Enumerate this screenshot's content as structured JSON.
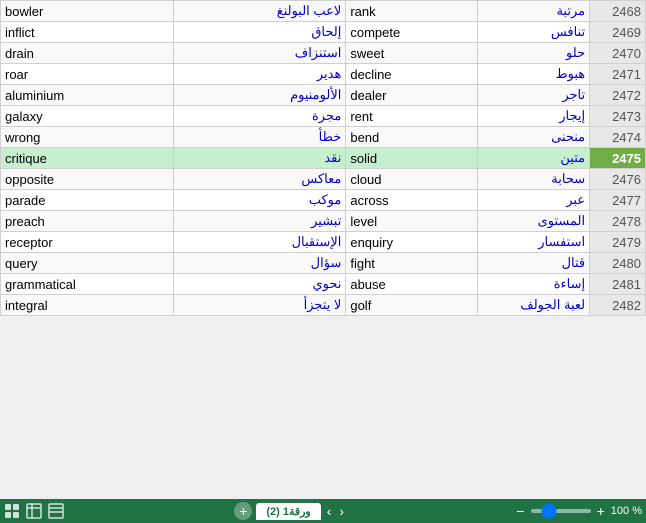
{
  "title": "Spreadsheet",
  "rows": [
    {
      "en": "bowler",
      "ar1": "لاعب البولنغ",
      "en2": "rank",
      "ar2": "مرتبة",
      "num": "2468",
      "highlight": false
    },
    {
      "en": "inflict",
      "ar1": "إلحاق",
      "en2": "compete",
      "ar2": "تنافس",
      "num": "2469",
      "highlight": false
    },
    {
      "en": "drain",
      "ar1": "استنزاف",
      "en2": "sweet",
      "ar2": "حلو",
      "num": "2470",
      "highlight": false
    },
    {
      "en": "roar",
      "ar1": "هدير",
      "en2": "decline",
      "ar2": "هبوط",
      "num": "2471",
      "highlight": false
    },
    {
      "en": "aluminium",
      "ar1": "الألومنيوم",
      "en2": "dealer",
      "ar2": "تاجر",
      "num": "2472",
      "highlight": false
    },
    {
      "en": "galaxy",
      "ar1": "مجرة",
      "en2": "rent",
      "ar2": "إيجار",
      "num": "2473",
      "highlight": false
    },
    {
      "en": "wrong",
      "ar1": "خطأً",
      "en2": "bend",
      "ar2": "منحنى",
      "num": "2474",
      "highlight": false
    },
    {
      "en": "critique",
      "ar1": "نقد",
      "en2": "solid",
      "ar2": "متين",
      "num": "2475",
      "highlight": true
    },
    {
      "en": "opposite",
      "ar1": "معاكس",
      "en2": "cloud",
      "ar2": "سحابة",
      "num": "2476",
      "highlight": false
    },
    {
      "en": "parade",
      "ar1": "موكب",
      "en2": "across",
      "ar2": "عبر",
      "num": "2477",
      "highlight": false
    },
    {
      "en": "preach",
      "ar1": "تبشير",
      "en2": "level",
      "ar2": "المستوى",
      "num": "2478",
      "highlight": false
    },
    {
      "en": "receptor",
      "ar1": "الإستقبال",
      "en2": "enquiry",
      "ar2": "استفسار",
      "num": "2479",
      "highlight": false
    },
    {
      "en": "query",
      "ar1": "سؤال",
      "en2": "fight",
      "ar2": "قتال",
      "num": "2480",
      "highlight": false
    },
    {
      "en": "grammatical",
      "ar1": "نحوي",
      "en2": "abuse",
      "ar2": "إساءة",
      "num": "2481",
      "highlight": false
    },
    {
      "en": "integral",
      "ar1": "لا يتجزأ",
      "en2": "golf",
      "ar2": "لعبة الجولف",
      "num": "2482",
      "highlight": false
    }
  ],
  "statusBar": {
    "sheetTab": "ورقة1 (2)",
    "zoomLabel": "100 %",
    "addSheetTitle": "Add Sheet"
  }
}
